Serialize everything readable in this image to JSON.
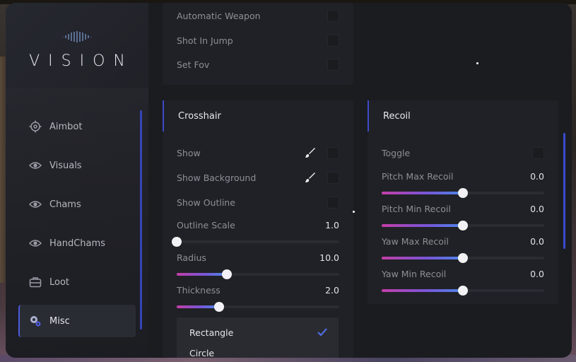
{
  "logo": {
    "text": "VISION",
    "small_text": ""
  },
  "sidebar": {
    "items": [
      {
        "label": "Aimbot",
        "icon": "crosshair-icon"
      },
      {
        "label": "Visuals",
        "icon": "eye-icon"
      },
      {
        "label": "Chams",
        "icon": "eye-icon"
      },
      {
        "label": "HandChams",
        "icon": "eye-icon"
      },
      {
        "label": "Loot",
        "icon": "briefcase-icon"
      },
      {
        "label": "Misc",
        "icon": "gears-icon",
        "active": true
      }
    ]
  },
  "top_panel": {
    "rows": [
      {
        "label": "Automatic Weapon",
        "checked": false
      },
      {
        "label": "Shot In Jump",
        "checked": false
      },
      {
        "label": "Set Fov",
        "checked": false
      }
    ]
  },
  "crosshair": {
    "title": "Crosshair",
    "show": {
      "label": "Show",
      "checked": false
    },
    "show_background": {
      "label": "Show Background",
      "checked": false
    },
    "show_outline": {
      "label": "Show Outline",
      "checked": false
    },
    "outline_scale": {
      "label": "Outline Scale",
      "value": "1.0",
      "fraction": 0.0
    },
    "radius": {
      "label": "Radius",
      "value": "10.0",
      "fraction": 0.31
    },
    "thickness": {
      "label": "Thickness",
      "value": "2.0",
      "fraction": 0.26
    },
    "shape_options": [
      {
        "label": "Rectangle",
        "selected": true
      },
      {
        "label": "Circle",
        "selected": false
      }
    ]
  },
  "recoil": {
    "title": "Recoil",
    "toggle": {
      "label": "Toggle",
      "checked": false
    },
    "sliders": [
      {
        "label": "Pitch Max Recoil",
        "value": "0.0",
        "fraction": 0.5
      },
      {
        "label": "Pitch Min Recoil",
        "value": "0.0",
        "fraction": 0.5
      },
      {
        "label": "Yaw Max Recoil",
        "value": "0.0",
        "fraction": 0.5
      },
      {
        "label": "Yaw Min Recoil",
        "value": "0.0",
        "fraction": 0.5
      }
    ]
  },
  "colors": {
    "accent": "#3d4ac8",
    "slider_start": "#c43ea8",
    "slider_end": "#4a86e8"
  }
}
